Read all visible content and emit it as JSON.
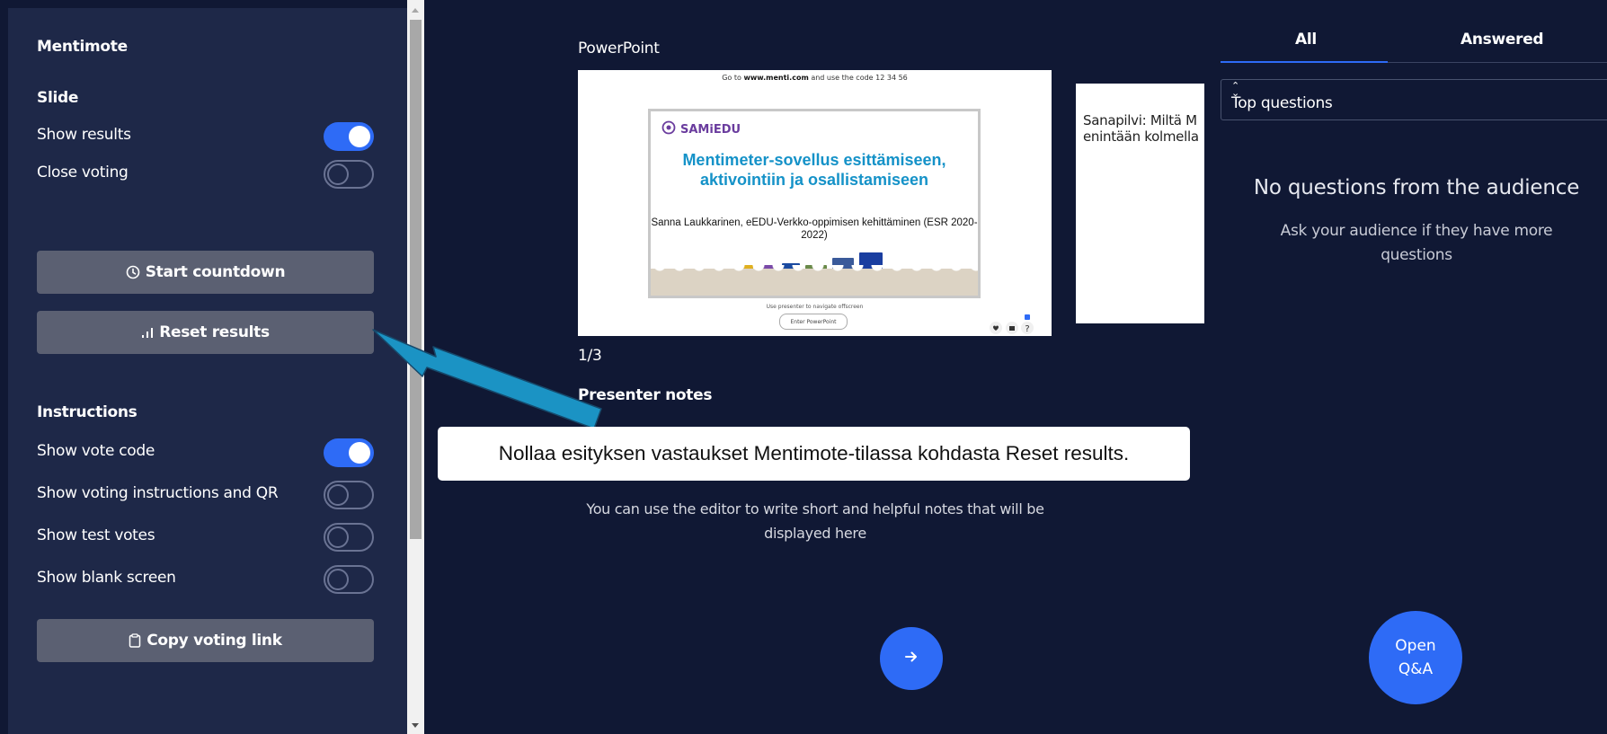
{
  "sidebar": {
    "app_title": "Mentimote",
    "slide_section": "Slide",
    "show_results": "Show results",
    "close_voting": "Close voting",
    "start_countdown": "Start countdown",
    "reset_results": "Reset results",
    "instructions_section": "Instructions",
    "show_vote_code": "Show vote code",
    "show_voting_instructions": "Show voting instructions and QR",
    "show_test_votes": "Show test votes",
    "show_blank_screen": "Show blank screen",
    "copy_voting_link": "Copy voting link",
    "toggles": {
      "show_results": true,
      "close_voting": false,
      "show_vote_code": true,
      "show_voting_instructions": false,
      "show_test_votes": false,
      "show_blank_screen": false
    }
  },
  "middle": {
    "powerpoint_label": "PowerPoint",
    "slide_counter": "1/3",
    "presenter_notes_label": "Presenter notes",
    "notes_empty": "You can use the editor to write short and helpful notes that will be displayed here",
    "current_slide": {
      "menti_prefix": "Go to ",
      "menti_url": "www.menti.com",
      "menti_suffix": " and use the code 12 34 56",
      "brand": "SAMiEDU",
      "title": "Mentimeter-sovellus esittämiseen, aktivointiin ja osallistamiseen",
      "subtitle": "Sanna Laukkarinen, eEDU-Verkko-oppimisen kehittäminen (ESR 2020-2022)",
      "bottom_hint": "Use presenter to navigate offscreen",
      "pill": "Enter PowerPoint"
    },
    "next_slide": {
      "line1": "Sanapilvi: Miltä M",
      "line2": "enintään kolmella"
    }
  },
  "right": {
    "tabs": [
      "All",
      "Answered"
    ],
    "active_tab": "All",
    "sort_select": "Top questions",
    "empty_title": "No questions from the audience",
    "empty_sub": "Ask your audience if they have more questions",
    "open_qa_line1": "Open",
    "open_qa_line2": "Q&A"
  },
  "callout": {
    "text": "Nollaa esityksen vastaukset Mentimote-tilassa kohdasta Reset results."
  },
  "colors": {
    "background": "#101834",
    "sidebar": "#1e2848",
    "accent": "#2e6bf6",
    "button": "#5b6072",
    "annotation_arrow": "#1b93c4"
  }
}
